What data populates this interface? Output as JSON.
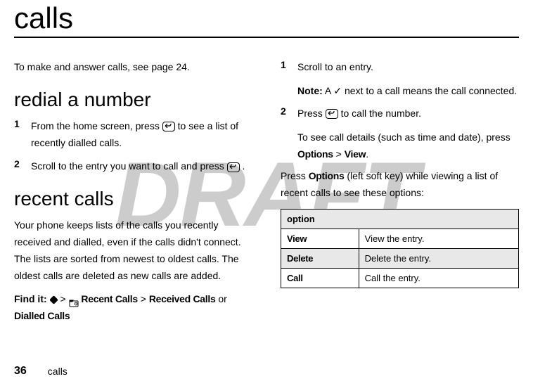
{
  "watermark": "DRAFT",
  "page_title": "calls",
  "intro_text": "To make and answer calls, see page 24.",
  "sections": {
    "redial": {
      "heading": "redial a number",
      "step1_prefix": "From the home screen, press ",
      "step1_suffix": " to see a list of recently dialled calls.",
      "step2_prefix": "Scroll to the entry you want to call and press ",
      "step2_suffix": "."
    },
    "recent": {
      "heading": "recent calls",
      "body": "Your phone keeps lists of the calls you recently received and dialled, even if the calls didn't connect. The lists are sorted from newest to oldest calls. The oldest calls are deleted as new calls are added.",
      "findit_label": "Find it: ",
      "findit_path1": "Recent Calls",
      "findit_sep": " > ",
      "findit_path2": "Received Calls",
      "findit_or": " or ",
      "findit_path3": "Dialled Calls"
    }
  },
  "right_col": {
    "step1": "Scroll to an entry.",
    "note_label": "Note:",
    "note_prefix": " A ",
    "note_suffix": " next to a call means the call connected.",
    "step2_prefix": "Press ",
    "step2_suffix": " to call the number.",
    "detail_prefix": "To see call details (such as time and date), press ",
    "detail_options": "Options",
    "detail_sep": " > ",
    "detail_view": "View",
    "detail_suffix": ".",
    "press_options_prefix": "Press ",
    "press_options_bold": "Options",
    "press_options_suffix": " (left soft key) while viewing a list of recent calls to see these options:"
  },
  "table": {
    "header": "option",
    "rows": [
      {
        "name": "View",
        "desc": "View the entry."
      },
      {
        "name": "Delete",
        "desc": "Delete the entry."
      },
      {
        "name": "Call",
        "desc": "Call the entry."
      }
    ]
  },
  "footer": {
    "page_num": "36",
    "section": "calls"
  },
  "icons": {
    "send_key": "⏎",
    "check": "✓"
  }
}
